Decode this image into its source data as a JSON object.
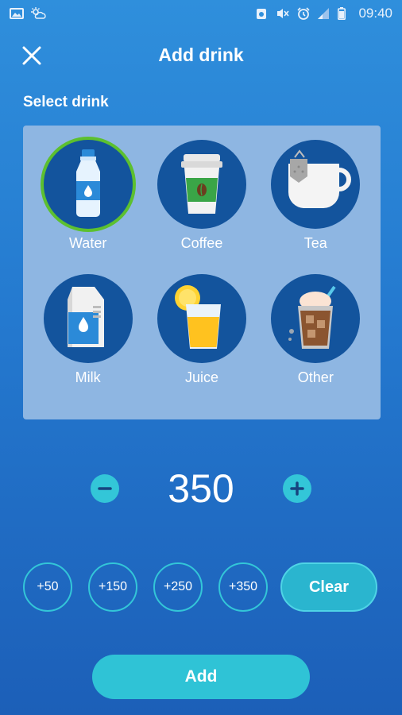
{
  "status_bar": {
    "time": "09:40",
    "left_icons": [
      "image-icon",
      "sun-cloud-icon"
    ],
    "right_icons": [
      "alarm-badge-icon",
      "mute-icon",
      "alarm-clock-icon",
      "signal-icon",
      "battery-icon"
    ]
  },
  "header": {
    "title": "Add drink",
    "close_icon": "close-icon"
  },
  "select_drink": {
    "label": "Select drink",
    "selected": "Water",
    "drinks": [
      {
        "label": "Water",
        "icon": "water-bottle-icon"
      },
      {
        "label": "Coffee",
        "icon": "coffee-cup-icon"
      },
      {
        "label": "Tea",
        "icon": "tea-cup-icon"
      },
      {
        "label": "Milk",
        "icon": "milk-carton-icon"
      },
      {
        "label": "Juice",
        "icon": "juice-glass-icon"
      },
      {
        "label": "Other",
        "icon": "iced-drink-icon"
      }
    ]
  },
  "amount": {
    "value": "350",
    "minus_icon": "minus-icon",
    "plus_icon": "plus-icon"
  },
  "quick_add": {
    "buttons": [
      "+50",
      "+150",
      "+250",
      "+350"
    ],
    "clear_label": "Clear"
  },
  "add_label": "Add",
  "colors": {
    "selected_ring": "#5cc02f",
    "accent": "#33c6d8",
    "panel": "#8eb6e2",
    "circle": "#13549d"
  }
}
